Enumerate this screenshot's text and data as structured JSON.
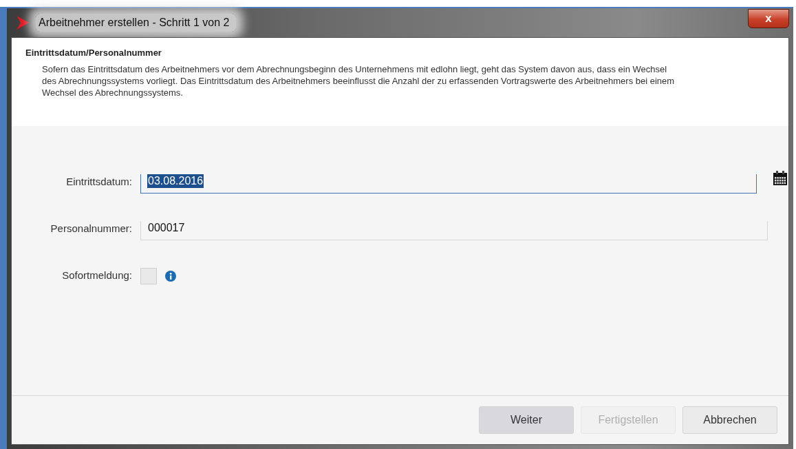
{
  "window": {
    "title": "Arbeitnehmer erstellen - Schritt 1 von 2",
    "close": "x"
  },
  "header": {
    "title": "Eintrittsdatum/Personalnummer",
    "description": "Sofern das Eintrittsdatum des Arbeitnehmers vor dem Abrechnungsbeginn des Unternehmens mit edlohn liegt, geht das System davon aus, dass ein Wechsel des Abrechnungssystems vorliegt. Das Eintrittsdatum des Arbeitnehmers beeinflusst die Anzahl der zu erfassenden Vortragswerte des Arbeitnehmers bei einem Wechsel des Abrechnungssystems."
  },
  "fields": [
    {
      "kind": "date",
      "label": "Eintrittsdatum:",
      "value": "03.08.2016",
      "focused": true
    },
    {
      "kind": "text",
      "label": "Personalnummer:",
      "value": "000017",
      "focused": false
    },
    {
      "kind": "checkbox",
      "label": "Sofortmeldung:",
      "checked": false
    }
  ],
  "buttons": [
    {
      "label": "Weiter",
      "default": true,
      "disabled": false
    },
    {
      "label": "Fertigstellen",
      "default": false,
      "disabled": true
    },
    {
      "label": "Abbrechen",
      "default": false,
      "disabled": false
    }
  ]
}
